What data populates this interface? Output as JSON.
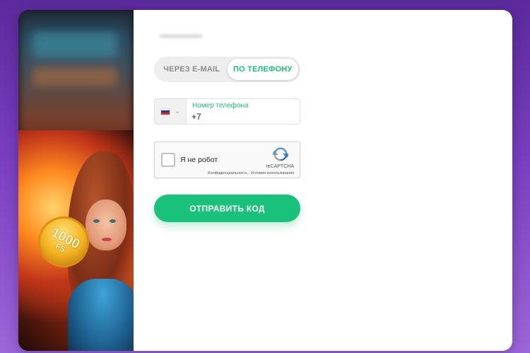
{
  "colors": {
    "accent": "#19c27a",
    "background_top": "#5b2a9c",
    "background_bottom": "#9d66d8",
    "panel": "#ffffff",
    "tab_track": "#eeeeee",
    "inactive_text": "#8a8a8a"
  },
  "promo": {
    "coin_value": "1000",
    "coin_unit": "FS"
  },
  "tabs": [
    {
      "label": "ЧЕРЕЗ E-MAIL",
      "active": false
    },
    {
      "label": "ПО ТЕЛЕФОНУ",
      "active": true
    }
  ],
  "phone": {
    "country_flag": "russia-flag-icon",
    "label": "Номер телефона",
    "value": "+7"
  },
  "captcha": {
    "checkbox_label": "Я не робот",
    "brand": "reCAPTCHA",
    "links": "Конфиденциальность - Условия использования",
    "checked": false
  },
  "submit": {
    "label": "ОТПРАВИТЬ КОД"
  }
}
